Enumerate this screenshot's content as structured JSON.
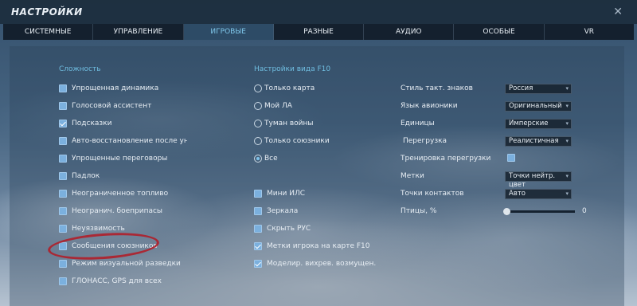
{
  "title": "НАСТРОЙКИ",
  "close_glyph": "✕",
  "tabs": [
    {
      "label": "СИСТЕМНЫЕ",
      "active": false
    },
    {
      "label": "УПРАВЛЕНИЕ",
      "active": false
    },
    {
      "label": "ИГРОВЫЕ",
      "active": true
    },
    {
      "label": "РАЗНЫЕ",
      "active": false
    },
    {
      "label": "АУДИО",
      "active": false
    },
    {
      "label": "ОСОБЫЕ",
      "active": false
    },
    {
      "label": "VR",
      "active": false
    }
  ],
  "difficulty": {
    "title": "Сложность",
    "items": [
      {
        "label": "Упрощенная динамика",
        "checked": false
      },
      {
        "label": "Голосовой ассистент",
        "checked": false
      },
      {
        "label": "Подсказки",
        "checked": true
      },
      {
        "label": "Авто-восстановление после уничтож",
        "checked": false
      },
      {
        "label": "Упрощенные переговоры",
        "checked": false
      },
      {
        "label": "Падлок",
        "checked": false
      },
      {
        "label": "Неограниченное топливо",
        "checked": false
      },
      {
        "label": "Неогранич. боеприпасы",
        "checked": false
      },
      {
        "label": "Неуязвимость",
        "checked": false
      },
      {
        "label": "Сообщения союзников",
        "checked": false
      },
      {
        "label": "Режим визуальной разведки",
        "checked": false
      },
      {
        "label": "ГЛОНАСС, GPS для всех",
        "checked": false
      }
    ]
  },
  "f10": {
    "title": "Настройки вида F10",
    "radios": [
      {
        "label": "Только карта",
        "selected": false
      },
      {
        "label": "Мой ЛА",
        "selected": false
      },
      {
        "label": "Туман войны",
        "selected": false
      },
      {
        "label": "Только союзники",
        "selected": false
      },
      {
        "label": "Все",
        "selected": true
      }
    ],
    "checks": [
      {
        "label": "Мини ИЛС",
        "checked": false
      },
      {
        "label": "Зеркала",
        "checked": false
      },
      {
        "label": "Скрыть РУС",
        "checked": false
      },
      {
        "label": "Метки игрока на карте F10",
        "checked": true
      },
      {
        "label": "Моделир. вихрев. возмущен.",
        "checked": true
      }
    ]
  },
  "settings": {
    "tactical_symbols": {
      "label": "Стиль такт. знаков",
      "value": "Россия"
    },
    "avionics_language": {
      "label": "Язык авионики",
      "value": "Оригинальный"
    },
    "units": {
      "label": "Единицы",
      "value": "Имперские"
    },
    "g_effects": {
      "label": "Перегрузка",
      "value": "Реалистичная"
    },
    "g_training": {
      "label": "Тренировка перегрузки",
      "checked": false
    },
    "labels": {
      "label": "Метки",
      "value": "Точки нейтр. цвет"
    },
    "contact_dots": {
      "label": "Точки контактов",
      "value": "Авто"
    },
    "birds": {
      "label": "Птицы, %",
      "value": "0",
      "fraction": 0
    }
  },
  "colors": {
    "accent": "#7fc7ea",
    "highlight_ring": "#b4192a"
  }
}
